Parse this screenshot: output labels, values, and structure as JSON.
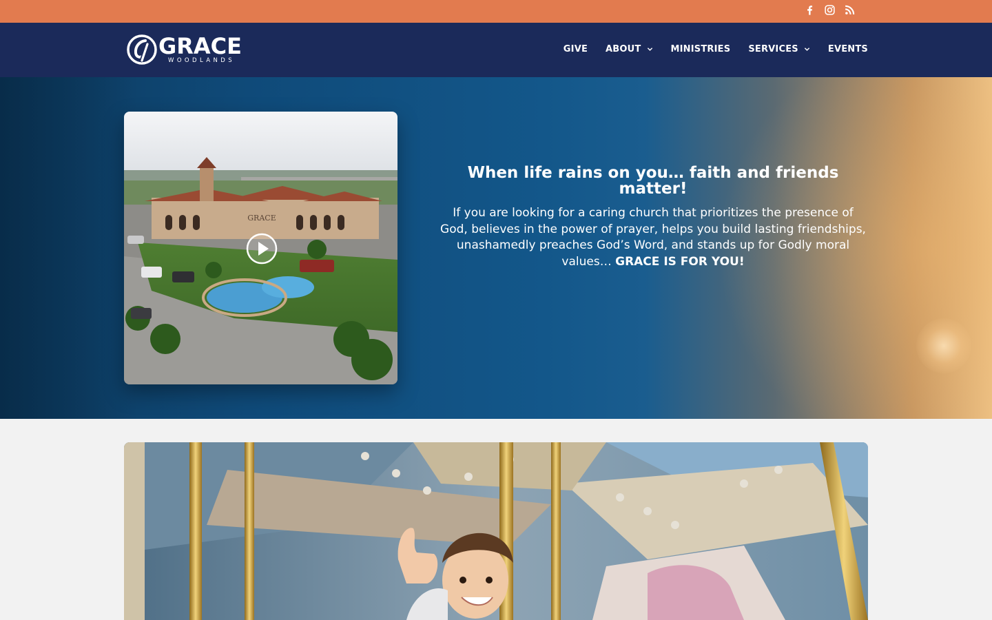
{
  "topbar": {
    "social": [
      {
        "icon": "facebook-icon"
      },
      {
        "icon": "instagram-icon"
      },
      {
        "icon": "rss-icon"
      }
    ],
    "bg_color": "#e27b4f"
  },
  "header": {
    "bg_color": "#1b2a5a",
    "logo": {
      "main": "GRACE",
      "sub": "WOODLANDS"
    },
    "nav": [
      {
        "label": "GIVE",
        "has_dropdown": false
      },
      {
        "label": "ABOUT",
        "has_dropdown": true
      },
      {
        "label": "MINISTRIES",
        "has_dropdown": false
      },
      {
        "label": "SERVICES",
        "has_dropdown": true
      },
      {
        "label": "EVENTS",
        "has_dropdown": false
      }
    ]
  },
  "hero": {
    "video": {
      "sign_text": "GRACE",
      "play_icon": "play-circle-icon"
    },
    "title": "When life rains on you… faith and friends matter!",
    "body": "If you are looking for a caring church that prioritizes the presence of God, believes in the power of prayer, helps you build lasting friendships, unashamedly preaches God’s Word, and stands up for Godly moral values… ",
    "body_bold": "GRACE IS FOR YOU!"
  },
  "feature": {
    "subject": "child on carousel"
  }
}
